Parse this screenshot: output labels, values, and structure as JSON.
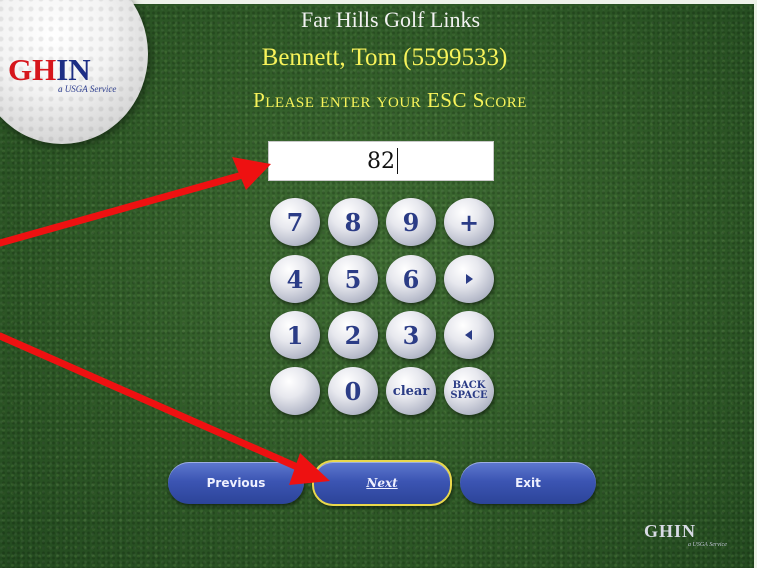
{
  "branding": {
    "logo_g": "GH",
    "logo_in": "IN",
    "logo_sub": "a USGA Service",
    "footer_logo": "GHIN",
    "footer_sub": "a USGA Service"
  },
  "header": {
    "course": "Far Hills Golf Links",
    "player": "Bennett, Tom (5599533)",
    "prompt": "Please enter your ESC Score"
  },
  "score_input": {
    "value": "82"
  },
  "keypad": {
    "row1": [
      "7",
      "8",
      "9",
      "+"
    ],
    "row2": [
      "4",
      "5",
      "6"
    ],
    "row3": [
      "1",
      "2",
      "3"
    ],
    "row4": [
      "",
      "0",
      "clear",
      "BACK SPACE"
    ]
  },
  "nav": {
    "previous": "Previous",
    "next": "Next",
    "exit": "Exit"
  },
  "colors": {
    "title_yellow": "#f7f35a",
    "button_blue": "#3c55b3",
    "next_border": "#e9d84c",
    "arrow_red": "#ee1111",
    "key_text": "#2b3c86"
  },
  "icons": {
    "right": "play-right-icon",
    "left": "play-left-icon"
  }
}
